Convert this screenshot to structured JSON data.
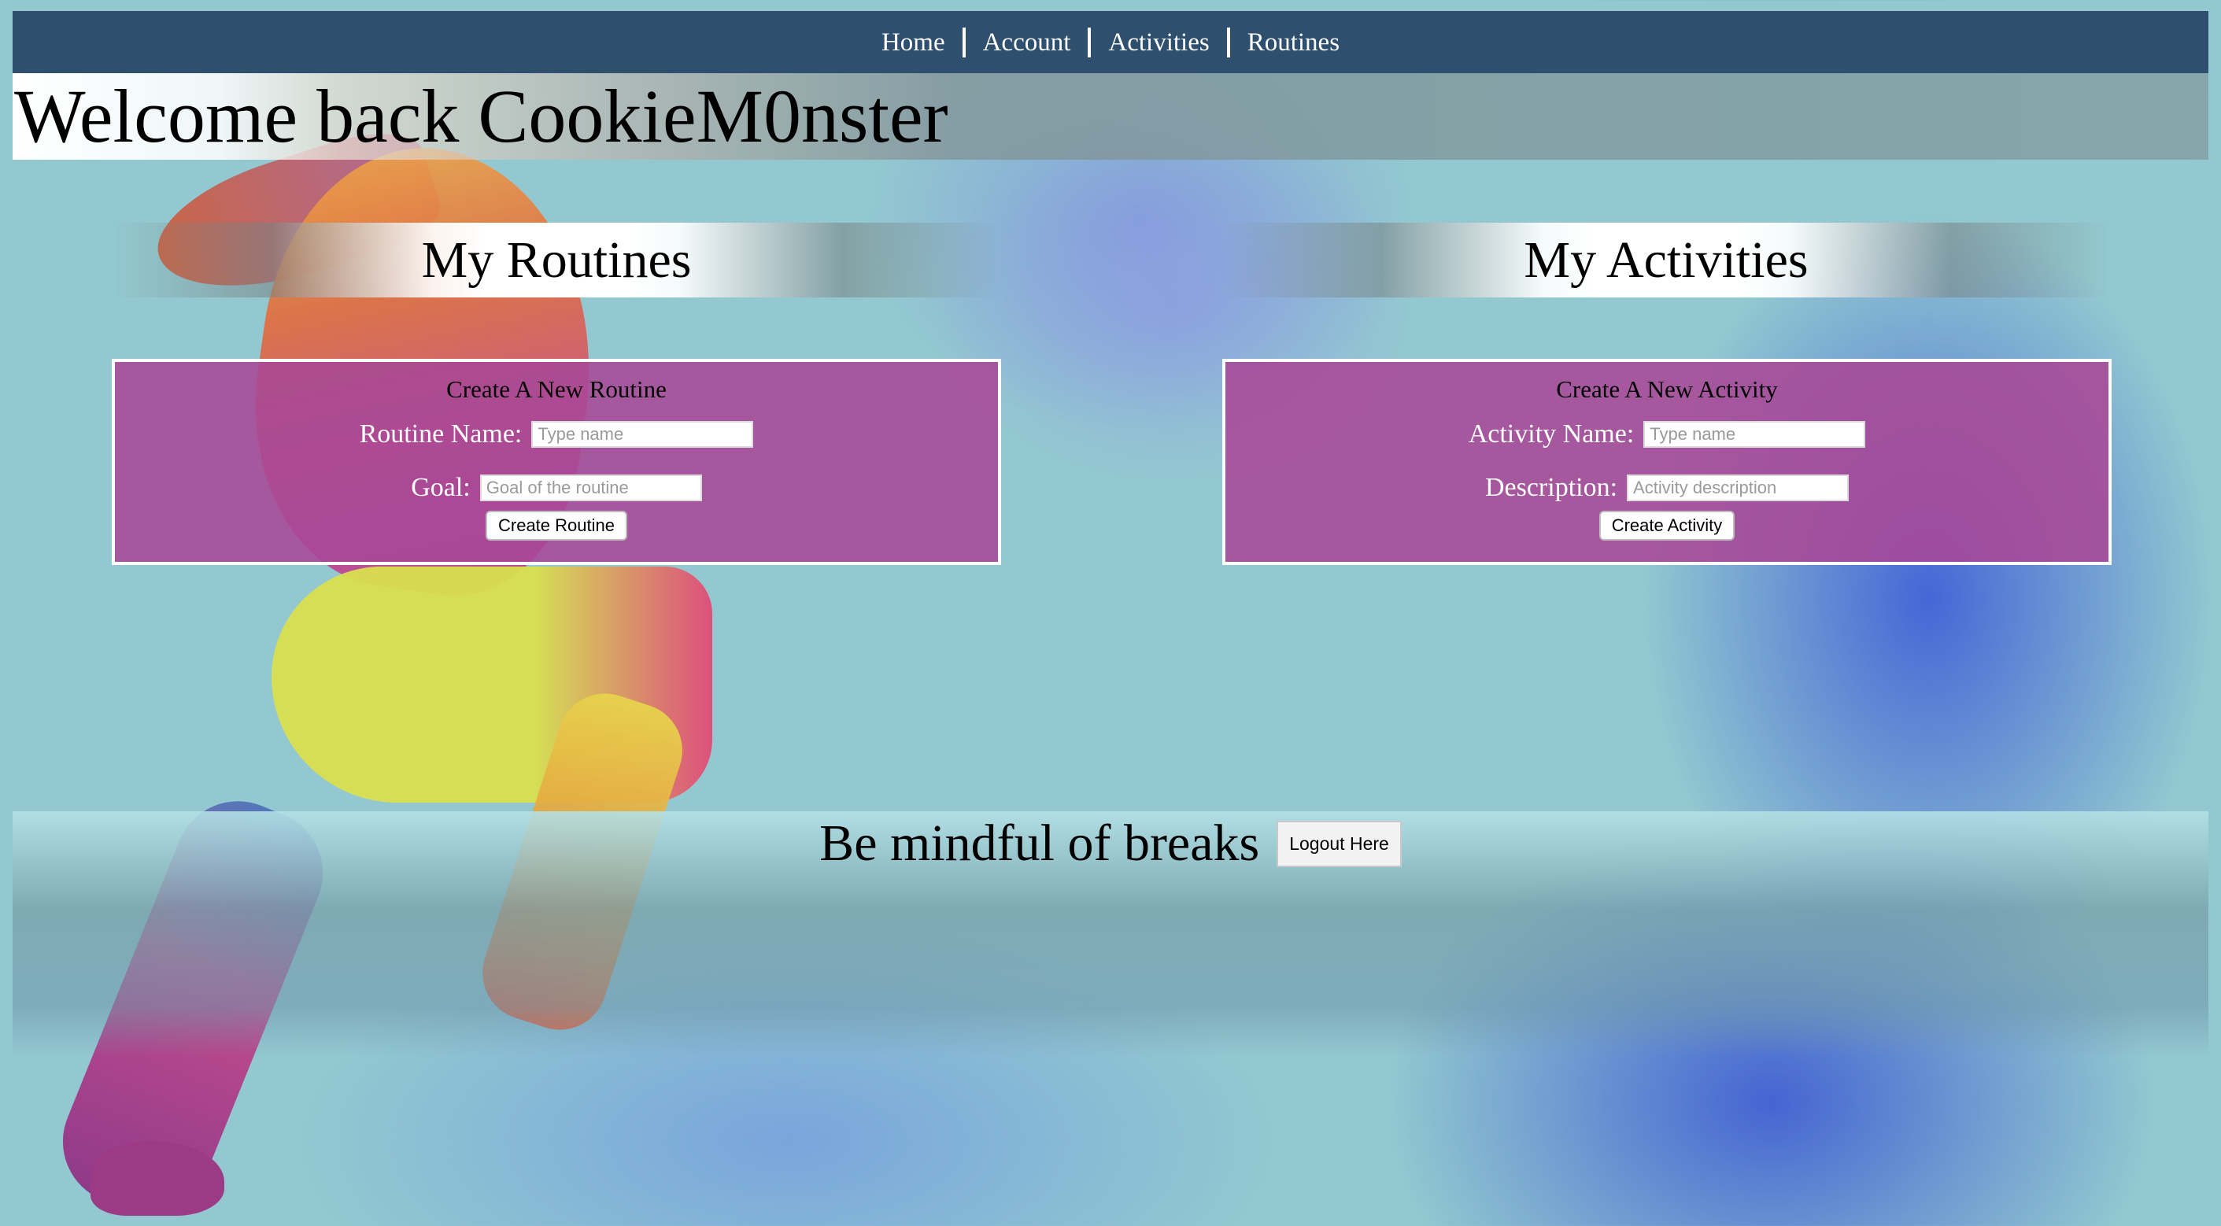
{
  "nav": {
    "items": [
      {
        "label": "Home"
      },
      {
        "label": "Account"
      },
      {
        "label": "Activities"
      },
      {
        "label": "Routines"
      }
    ]
  },
  "welcome": {
    "text": "Welcome back CookieM0nster"
  },
  "routines": {
    "header": "My Routines",
    "form": {
      "title": "Create A New Routine",
      "name_label": "Routine Name:",
      "name_placeholder": "Type name",
      "name_value": "",
      "goal_label": "Goal:",
      "goal_placeholder": "Goal of the routine",
      "goal_value": "",
      "submit_label": "Create Routine"
    }
  },
  "activities": {
    "header": "My Activities",
    "form": {
      "title": "Create A New Activity",
      "name_label": "Activity Name:",
      "name_placeholder": "Type name",
      "name_value": "",
      "description_label": "Description:",
      "description_placeholder": "Activity description",
      "description_value": "",
      "submit_label": "Create Activity"
    }
  },
  "footer": {
    "tagline": "Be mindful of breaks",
    "logout_label": "Logout Here"
  },
  "colors": {
    "nav_bg": "#2f4f6f",
    "panel_bg": "#a84896",
    "page_bg": "#93c8d0"
  }
}
